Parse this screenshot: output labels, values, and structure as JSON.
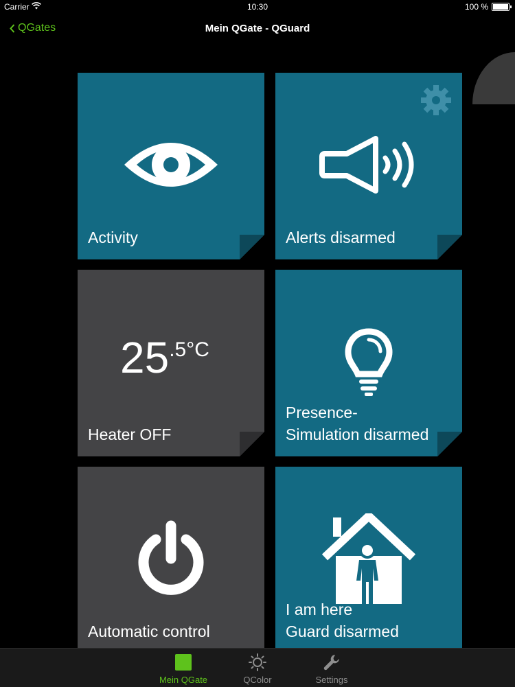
{
  "status_bar": {
    "carrier": "Carrier",
    "time": "10:30",
    "battery": "100 %"
  },
  "nav": {
    "back_label": "QGates",
    "title": "Mein QGate  - QGuard"
  },
  "tiles": {
    "activity": {
      "label": "Activity"
    },
    "alerts": {
      "label": "Alerts disarmed"
    },
    "heater": {
      "temp_whole": "25",
      "temp_decimal": ".5°C",
      "label": "Heater OFF"
    },
    "presence": {
      "line1": "Presence-",
      "line2": "Simulation disarmed"
    },
    "automatic": {
      "label": "Automatic control"
    },
    "guard": {
      "line1": "I am here",
      "line2": "Guard disarmed"
    }
  },
  "tab_bar": {
    "items": [
      {
        "label": "Mein QGate",
        "icon": "qgate-square-icon",
        "active": true
      },
      {
        "label": "QColor",
        "icon": "sun-icon",
        "active": false
      },
      {
        "label": "Settings",
        "icon": "wrench-icon",
        "active": false
      }
    ]
  },
  "colors": {
    "accent": "#5ec21c",
    "tile_teal": "#136a83",
    "tile_gray": "#444446",
    "background": "#000000"
  }
}
